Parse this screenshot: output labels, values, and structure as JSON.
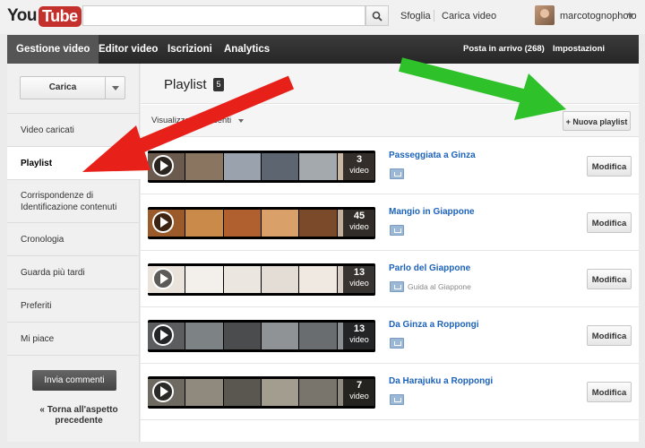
{
  "header": {
    "logo_you": "You",
    "logo_tube": "Tube",
    "search": {
      "value": "",
      "placeholder": ""
    },
    "links": {
      "browse": "Sfoglia",
      "upload": "Carica video"
    },
    "username": "marcotognophoto"
  },
  "nav": {
    "items": [
      {
        "label": "Gestione video",
        "active": true
      },
      {
        "label": "Editor video",
        "active": false
      },
      {
        "label": "Iscrizioni",
        "active": false
      },
      {
        "label": "Analytics",
        "active": false
      }
    ],
    "inbox": "Posta in arrivo (268)",
    "account": "Impostazioni account"
  },
  "sidebar": {
    "upload_label": "Carica",
    "items": [
      {
        "label": "Video caricati",
        "selected": false
      },
      {
        "label": "Playlist",
        "selected": true
      },
      {
        "label": "Corrispondenze di Identificazione contenuti",
        "selected": false
      },
      {
        "label": "Cronologia",
        "selected": false
      },
      {
        "label": "Guarda più tardi",
        "selected": false
      },
      {
        "label": "Preferiti",
        "selected": false
      },
      {
        "label": "Mi piace",
        "selected": false
      }
    ],
    "feedback_label": "Invia commenti",
    "old_look_label": "« Torna all'aspetto precedente"
  },
  "main": {
    "title": "Playlist",
    "count": "5",
    "sort_label": "Visualizza più recenti",
    "new_playlist_label": "+ Nuova playlist",
    "edit_label": "Modifica",
    "video_word": "video",
    "playlists": [
      {
        "title": "Passeggiata a Ginza",
        "count": "3",
        "subtitle": "",
        "frames": [
          "#6b5a4e",
          "#8a7560",
          "#9aa3ad",
          "#5d6670",
          "#a4a9ad",
          "#c9b7a4"
        ]
      },
      {
        "title": "Mangio in Giappone",
        "count": "45",
        "subtitle": "",
        "frames": [
          "#9b5a2a",
          "#c98a4a",
          "#b0602e",
          "#d9a06a",
          "#7a4a2a",
          "#c4b09a"
        ]
      },
      {
        "title": "Parlo del Giappone",
        "count": "13",
        "subtitle": "Guida al Giappone",
        "frames": [
          "#e9e3dc",
          "#f3efea",
          "#ebe6e0",
          "#e4ddd6",
          "#efe9e2",
          "#d9cfc6"
        ]
      },
      {
        "title": "Da Ginza a Roppongi",
        "count": "13",
        "subtitle": "",
        "frames": [
          "#5b5d5f",
          "#7d8285",
          "#4a4c4e",
          "#8f9396",
          "#6a6d70",
          "#8b8f92"
        ]
      },
      {
        "title": "Da Harajuku a Roppongi",
        "count": "7",
        "subtitle": "",
        "frames": [
          "#6e6a62",
          "#908a7e",
          "#5a5650",
          "#a39d90",
          "#7a756c",
          "#8f8a7f"
        ]
      }
    ]
  },
  "colors": {
    "red_arrow": "#e8201a",
    "green_arrow": "#2fc12a",
    "link_blue": "#1c62b9",
    "nav_dark": "#2e2e2e"
  }
}
